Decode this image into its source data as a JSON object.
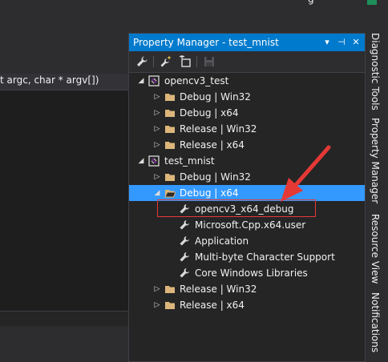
{
  "window": {
    "top_text": "g"
  },
  "editor": {
    "nav_text": "t argc, char * argv[])"
  },
  "panel": {
    "title": "Property Manager - test_mnist",
    "title_buttons": {
      "dropdown": "▾",
      "pin": "⊣",
      "close": "✕"
    },
    "toolbar_icons": [
      "properties-wrench-icon",
      "add-property-sheet-icon",
      "add-existing-sheet-icon",
      "save-icon"
    ]
  },
  "tree": {
    "opencv3_test": {
      "label": "opencv3_test",
      "children": [
        "Debug | Win32",
        "Debug | x64",
        "Release | Win32",
        "Release | x64"
      ]
    },
    "test_mnist": {
      "label": "test_mnist",
      "children": {
        "debug_win32": "Debug | Win32",
        "debug_x64": {
          "label": "Debug | x64",
          "sheets": [
            "opencv3_x64_debug",
            "Microsoft.Cpp.x64.user",
            "Application",
            "Multi-byte Character Support",
            "Core Windows Libraries"
          ]
        },
        "release_win32": "Release | Win32",
        "release_x64": "Release | x64"
      }
    }
  },
  "side_tabs": [
    "Diagnostic Tools",
    "Property Manager",
    "Resource View",
    "Notifications"
  ],
  "colors": {
    "accent": "#007acc",
    "selection": "#3399ff",
    "annotation": "#e53935",
    "folder": "#dcb67a"
  }
}
